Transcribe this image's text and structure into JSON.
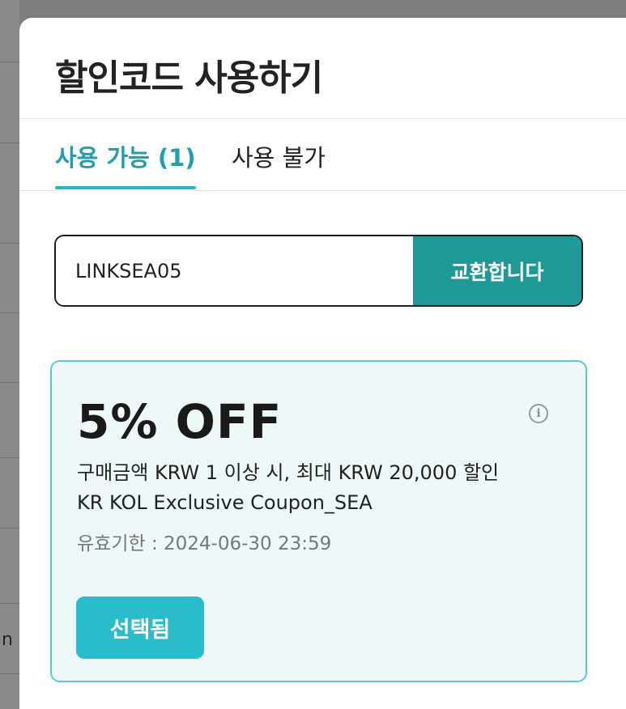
{
  "background": {
    "text_fragment": "n"
  },
  "modal": {
    "title": "할인코드 사용하기"
  },
  "tabs": [
    {
      "label": "사용 가능 (1)",
      "active": true
    },
    {
      "label": "사용 불가",
      "active": false
    }
  ],
  "code_entry": {
    "value": "LINKSEA05",
    "button_label": "교환합니다"
  },
  "coupon": {
    "amount": "5% OFF",
    "info_icon": "info-icon",
    "condition": "구매금액 KRW 1 이상 시, 최대 KRW 20,000 할인",
    "name": "KR KOL Exclusive Coupon_SEA",
    "expiry": "유효기한 : 2024-06-30 23:59",
    "select_label": "선택됨"
  },
  "colors": {
    "accent": "#26b6c6",
    "button_dark": "#1f9898",
    "coupon_bg": "#eef8f9",
    "coupon_border": "#5cc6d2"
  }
}
